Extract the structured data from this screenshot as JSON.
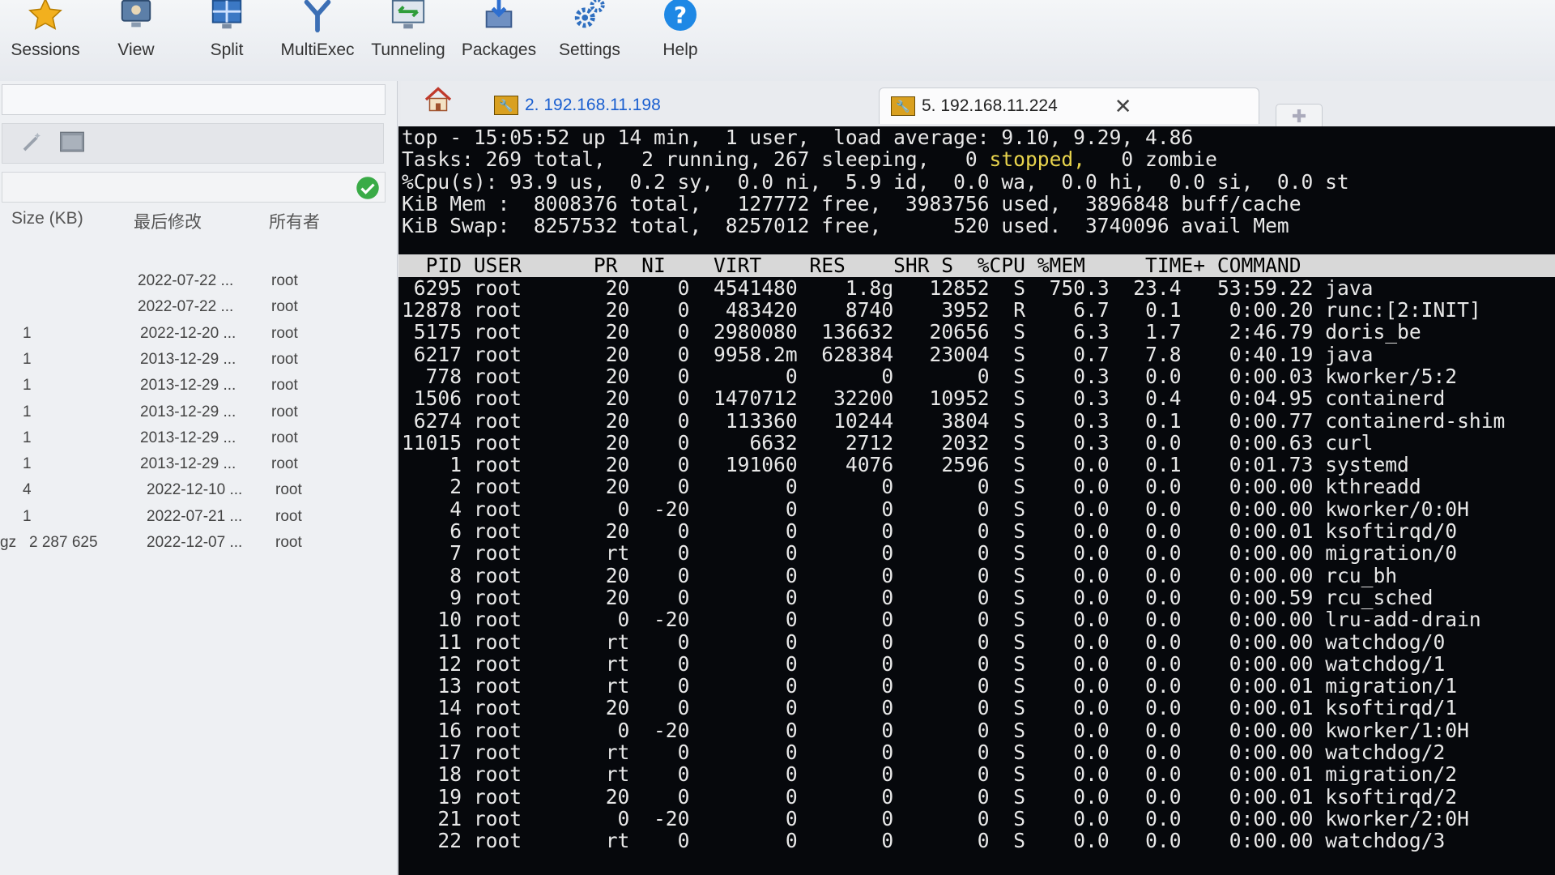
{
  "toolbar": {
    "items": [
      {
        "label": "Sessions",
        "icon": "star-icon"
      },
      {
        "label": "View",
        "icon": "monitor-icon"
      },
      {
        "label": "Split",
        "icon": "split-icon"
      },
      {
        "label": "MultiExec",
        "icon": "fork-icon"
      },
      {
        "label": "Tunneling",
        "icon": "tunnel-icon"
      },
      {
        "label": "Packages",
        "icon": "package-icon"
      },
      {
        "label": "Settings",
        "icon": "gears-icon"
      },
      {
        "label": "Help",
        "icon": "help-icon"
      }
    ]
  },
  "file_panel": {
    "columns": [
      "Size (KB)",
      "最后修改",
      "所有者"
    ],
    "rows": [
      {
        "prefix": "",
        "size": "",
        "modified": "2022-07-22 ...",
        "owner": "root"
      },
      {
        "prefix": "",
        "size": "",
        "modified": "2022-07-22 ...",
        "owner": "root"
      },
      {
        "prefix": "",
        "size": "1",
        "modified": "2022-12-20 ...",
        "owner": "root"
      },
      {
        "prefix": "",
        "size": "1",
        "modified": "2013-12-29 ...",
        "owner": "root"
      },
      {
        "prefix": "",
        "size": "1",
        "modified": "2013-12-29 ...",
        "owner": "root"
      },
      {
        "prefix": "",
        "size": "1",
        "modified": "2013-12-29 ...",
        "owner": "root"
      },
      {
        "prefix": "",
        "size": "1",
        "modified": "2013-12-29 ...",
        "owner": "root"
      },
      {
        "prefix": "",
        "size": "1",
        "modified": "2013-12-29 ...",
        "owner": "root"
      },
      {
        "prefix": "",
        "size": "4",
        "modified": "2022-12-10 ...",
        "owner": "root"
      },
      {
        "prefix": "",
        "size": "1",
        "modified": "2022-07-21 ...",
        "owner": "root"
      },
      {
        "prefix": "gz",
        "size": "2 287 625",
        "modified": "2022-12-07 ...",
        "owner": "root"
      }
    ]
  },
  "tabs": [
    {
      "label": "2. 192.168.11.198",
      "active": false
    },
    {
      "label": "5. 192.168.11.224",
      "active": true
    }
  ],
  "terminal": {
    "header": {
      "line1": "top - 15:05:52 up 14 min,  1 user,  load average: 9.10, 9.29, 4.86",
      "line2_pre": "Tasks: 269 total,   2 running, 267 sleeping,   0 ",
      "line2_stopped": "stopped,",
      "line2_post": "   0 zombie",
      "line3": "%Cpu(s): 93.9 us,  0.2 sy,  0.0 ni,  5.9 id,  0.0 wa,  0.0 hi,  0.0 si,  0.0 st",
      "line4": "KiB Mem :  8008376 total,   127772 free,  3983756 used,  3896848 buff/cache",
      "line5": "KiB Swap:  8257532 total,  8257012 free,      520 used.  3740096 avail Mem"
    },
    "table_header": "  PID USER      PR  NI    VIRT    RES    SHR S  %CPU %MEM     TIME+ COMMAND",
    "processes": [
      {
        "pid": "6295",
        "user": "root",
        "pr": "20",
        "ni": "0",
        "virt": "4541480",
        "res": "1.8g",
        "shr": "12852",
        "s": "S",
        "cpu": "750.3",
        "mem": "23.4",
        "time": "53:59.22",
        "cmd": "java"
      },
      {
        "pid": "12878",
        "user": "root",
        "pr": "20",
        "ni": "0",
        "virt": "483420",
        "res": "8740",
        "shr": "3952",
        "s": "R",
        "cpu": "6.7",
        "mem": "0.1",
        "time": "0:00.20",
        "cmd": "runc:[2:INIT]"
      },
      {
        "pid": "5175",
        "user": "root",
        "pr": "20",
        "ni": "0",
        "virt": "2980080",
        "res": "136632",
        "shr": "20656",
        "s": "S",
        "cpu": "6.3",
        "mem": "1.7",
        "time": "2:46.79",
        "cmd": "doris_be"
      },
      {
        "pid": "6217",
        "user": "root",
        "pr": "20",
        "ni": "0",
        "virt": "9958.2m",
        "res": "628384",
        "shr": "23004",
        "s": "S",
        "cpu": "0.7",
        "mem": "7.8",
        "time": "0:40.19",
        "cmd": "java"
      },
      {
        "pid": "778",
        "user": "root",
        "pr": "20",
        "ni": "0",
        "virt": "0",
        "res": "0",
        "shr": "0",
        "s": "S",
        "cpu": "0.3",
        "mem": "0.0",
        "time": "0:00.03",
        "cmd": "kworker/5:2"
      },
      {
        "pid": "1506",
        "user": "root",
        "pr": "20",
        "ni": "0",
        "virt": "1470712",
        "res": "32200",
        "shr": "10952",
        "s": "S",
        "cpu": "0.3",
        "mem": "0.4",
        "time": "0:04.95",
        "cmd": "containerd"
      },
      {
        "pid": "6274",
        "user": "root",
        "pr": "20",
        "ni": "0",
        "virt": "113360",
        "res": "10244",
        "shr": "3804",
        "s": "S",
        "cpu": "0.3",
        "mem": "0.1",
        "time": "0:00.77",
        "cmd": "containerd-shim"
      },
      {
        "pid": "11015",
        "user": "root",
        "pr": "20",
        "ni": "0",
        "virt": "6632",
        "res": "2712",
        "shr": "2032",
        "s": "S",
        "cpu": "0.3",
        "mem": "0.0",
        "time": "0:00.63",
        "cmd": "curl"
      },
      {
        "pid": "1",
        "user": "root",
        "pr": "20",
        "ni": "0",
        "virt": "191060",
        "res": "4076",
        "shr": "2596",
        "s": "S",
        "cpu": "0.0",
        "mem": "0.1",
        "time": "0:01.73",
        "cmd": "systemd"
      },
      {
        "pid": "2",
        "user": "root",
        "pr": "20",
        "ni": "0",
        "virt": "0",
        "res": "0",
        "shr": "0",
        "s": "S",
        "cpu": "0.0",
        "mem": "0.0",
        "time": "0:00.00",
        "cmd": "kthreadd"
      },
      {
        "pid": "4",
        "user": "root",
        "pr": "0",
        "ni": "-20",
        "virt": "0",
        "res": "0",
        "shr": "0",
        "s": "S",
        "cpu": "0.0",
        "mem": "0.0",
        "time": "0:00.00",
        "cmd": "kworker/0:0H"
      },
      {
        "pid": "6",
        "user": "root",
        "pr": "20",
        "ni": "0",
        "virt": "0",
        "res": "0",
        "shr": "0",
        "s": "S",
        "cpu": "0.0",
        "mem": "0.0",
        "time": "0:00.01",
        "cmd": "ksoftirqd/0"
      },
      {
        "pid": "7",
        "user": "root",
        "pr": "rt",
        "ni": "0",
        "virt": "0",
        "res": "0",
        "shr": "0",
        "s": "S",
        "cpu": "0.0",
        "mem": "0.0",
        "time": "0:00.00",
        "cmd": "migration/0"
      },
      {
        "pid": "8",
        "user": "root",
        "pr": "20",
        "ni": "0",
        "virt": "0",
        "res": "0",
        "shr": "0",
        "s": "S",
        "cpu": "0.0",
        "mem": "0.0",
        "time": "0:00.00",
        "cmd": "rcu_bh"
      },
      {
        "pid": "9",
        "user": "root",
        "pr": "20",
        "ni": "0",
        "virt": "0",
        "res": "0",
        "shr": "0",
        "s": "S",
        "cpu": "0.0",
        "mem": "0.0",
        "time": "0:00.59",
        "cmd": "rcu_sched"
      },
      {
        "pid": "10",
        "user": "root",
        "pr": "0",
        "ni": "-20",
        "virt": "0",
        "res": "0",
        "shr": "0",
        "s": "S",
        "cpu": "0.0",
        "mem": "0.0",
        "time": "0:00.00",
        "cmd": "lru-add-drain"
      },
      {
        "pid": "11",
        "user": "root",
        "pr": "rt",
        "ni": "0",
        "virt": "0",
        "res": "0",
        "shr": "0",
        "s": "S",
        "cpu": "0.0",
        "mem": "0.0",
        "time": "0:00.00",
        "cmd": "watchdog/0"
      },
      {
        "pid": "12",
        "user": "root",
        "pr": "rt",
        "ni": "0",
        "virt": "0",
        "res": "0",
        "shr": "0",
        "s": "S",
        "cpu": "0.0",
        "mem": "0.0",
        "time": "0:00.00",
        "cmd": "watchdog/1"
      },
      {
        "pid": "13",
        "user": "root",
        "pr": "rt",
        "ni": "0",
        "virt": "0",
        "res": "0",
        "shr": "0",
        "s": "S",
        "cpu": "0.0",
        "mem": "0.0",
        "time": "0:00.01",
        "cmd": "migration/1"
      },
      {
        "pid": "14",
        "user": "root",
        "pr": "20",
        "ni": "0",
        "virt": "0",
        "res": "0",
        "shr": "0",
        "s": "S",
        "cpu": "0.0",
        "mem": "0.0",
        "time": "0:00.01",
        "cmd": "ksoftirqd/1"
      },
      {
        "pid": "16",
        "user": "root",
        "pr": "0",
        "ni": "-20",
        "virt": "0",
        "res": "0",
        "shr": "0",
        "s": "S",
        "cpu": "0.0",
        "mem": "0.0",
        "time": "0:00.00",
        "cmd": "kworker/1:0H"
      },
      {
        "pid": "17",
        "user": "root",
        "pr": "rt",
        "ni": "0",
        "virt": "0",
        "res": "0",
        "shr": "0",
        "s": "S",
        "cpu": "0.0",
        "mem": "0.0",
        "time": "0:00.00",
        "cmd": "watchdog/2"
      },
      {
        "pid": "18",
        "user": "root",
        "pr": "rt",
        "ni": "0",
        "virt": "0",
        "res": "0",
        "shr": "0",
        "s": "S",
        "cpu": "0.0",
        "mem": "0.0",
        "time": "0:00.01",
        "cmd": "migration/2"
      },
      {
        "pid": "19",
        "user": "root",
        "pr": "20",
        "ni": "0",
        "virt": "0",
        "res": "0",
        "shr": "0",
        "s": "S",
        "cpu": "0.0",
        "mem": "0.0",
        "time": "0:00.01",
        "cmd": "ksoftirqd/2"
      },
      {
        "pid": "21",
        "user": "root",
        "pr": "0",
        "ni": "-20",
        "virt": "0",
        "res": "0",
        "shr": "0",
        "s": "S",
        "cpu": "0.0",
        "mem": "0.0",
        "time": "0:00.00",
        "cmd": "kworker/2:0H"
      },
      {
        "pid": "22",
        "user": "root",
        "pr": "rt",
        "ni": "0",
        "virt": "0",
        "res": "0",
        "shr": "0",
        "s": "S",
        "cpu": "0.0",
        "mem": "0.0",
        "time": "0:00.00",
        "cmd": "watchdog/3"
      }
    ]
  },
  "colors": {
    "terminal_bg": "#06080c",
    "terminal_fg": "#e8e8e8",
    "stopped_highlight": "#e8d44d",
    "tab_link": "#1a5fd0",
    "ok_green": "#3aab47"
  }
}
